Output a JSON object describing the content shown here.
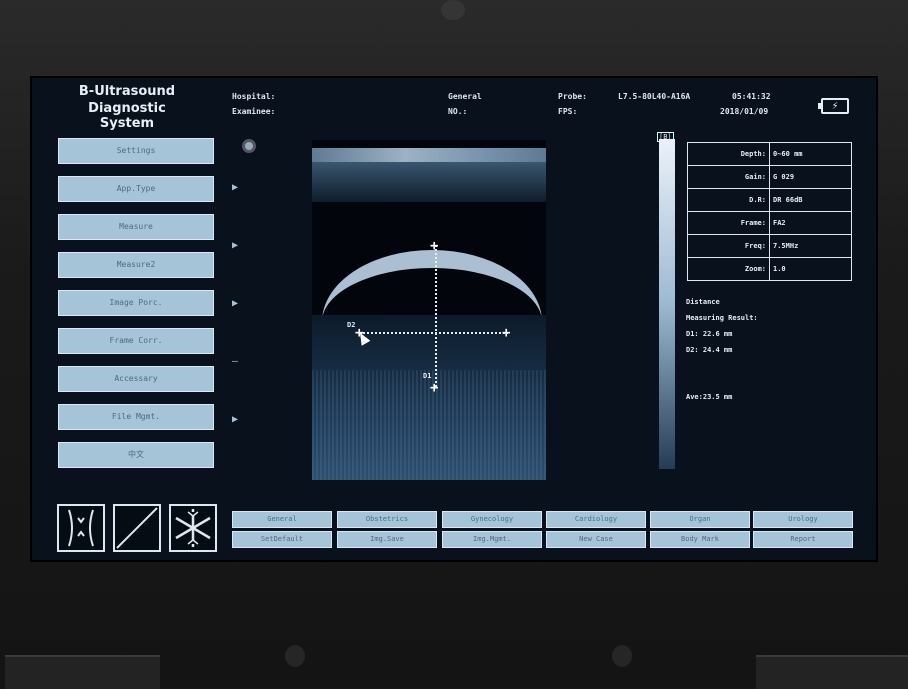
{
  "title": {
    "line1": "B-Ultrasound",
    "line2": "Diagnostic System"
  },
  "header": {
    "hospital_label": "Hospital:",
    "examinee_label": "Examinee:",
    "mode": "General",
    "no_label": "NO.:",
    "probe_label": "Probe:",
    "probe_value": "L7.5-80L40-A16A",
    "fps_label": "FPS:",
    "time": "05:41:32",
    "date": "2018/01/09",
    "battery_symbol": "⚡"
  },
  "menu": [
    {
      "label": "Settings"
    },
    {
      "label": "App.Type"
    },
    {
      "label": "Measure"
    },
    {
      "label": "Measure2"
    },
    {
      "label": "Image Porc."
    },
    {
      "label": "Frame Corr."
    },
    {
      "label": "Accessary"
    },
    {
      "label": "File Mgmt."
    },
    {
      "label": "中文"
    }
  ],
  "indicators": {
    "arrow": "▶",
    "dash": "–"
  },
  "image": {
    "d1_label": "D1",
    "d2_label": "D2"
  },
  "graybar": {
    "label": "[B]"
  },
  "params": [
    {
      "key": "Depth:",
      "value": "0~60 mm"
    },
    {
      "key": "Gain:",
      "value": "G 029"
    },
    {
      "key": "D.R:",
      "value": "DR 66dB"
    },
    {
      "key": "Frame:",
      "value": "FA2"
    },
    {
      "key": "Freq:",
      "value": "7.5MHz"
    },
    {
      "key": "Zoom:",
      "value": "1.0"
    }
  ],
  "measurement": {
    "title": "Distance",
    "subtitle": "Measuring Result:",
    "d1": "D1: 22.6 mm",
    "d2": "D2: 24.4 mm",
    "ave": "Ave:23.5 mm"
  },
  "icons": [
    "body-mark-icon",
    "probe-orientation-icon",
    "freeze-snowflake-icon"
  ],
  "presets_row1": [
    "General",
    "Obstetrics",
    "Gynecology",
    "Cardiology",
    "Organ",
    "Urology"
  ],
  "presets_row2": [
    "SetDefault",
    "Img.Save",
    "Img.Mgmt.",
    "New Case",
    "Body Mark",
    "Report"
  ]
}
